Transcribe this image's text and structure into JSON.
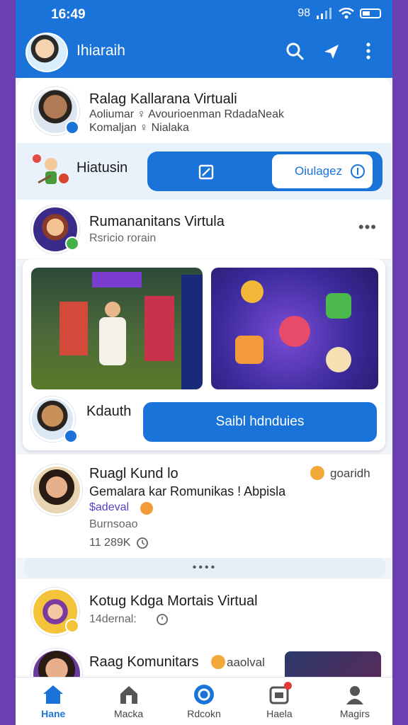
{
  "status_bar": {
    "time": "16:49",
    "signal_text": "98"
  },
  "header": {
    "title": "Ihiaraih"
  },
  "feed": {
    "card1": {
      "name": "Ralag Kallarana Virtuali",
      "line1": "Aoliumar ♀ Avourioenman RdadaNeak",
      "line2": "Komaljan ♀ Nialaka"
    },
    "action": {
      "label": "Hiatusin",
      "secondary_label": "Oiulagez"
    },
    "card2": {
      "name": "Rumananitans Virtula",
      "meta": "Rsricio rorain",
      "more": "•••"
    },
    "post": {
      "author": "Kdauth",
      "button_label": "Saibl hdnduies"
    },
    "card3": {
      "name": "Ruagl Kund lo",
      "tag": "goaridh",
      "line1": "Gemalara kar Romunikas ! Abpisla",
      "link": "$adeval",
      "line3": "Burnsoao",
      "time": "11 289K"
    },
    "pager": {
      "dots": "••••"
    },
    "card4": {
      "name": "Kotug Kdga Mortais Virtual",
      "meta": "14dernal:"
    },
    "card5": {
      "name": "Raag Komunitars",
      "tag": "aaolval"
    }
  },
  "bottom_nav": {
    "items": [
      {
        "label": "Hane"
      },
      {
        "label": "Macka"
      },
      {
        "label": "Rdcokn"
      },
      {
        "label": "Haela"
      },
      {
        "label": "Magirs"
      }
    ]
  },
  "colors": {
    "primary": "#1a73d8",
    "frame": "#6a3fb0"
  }
}
